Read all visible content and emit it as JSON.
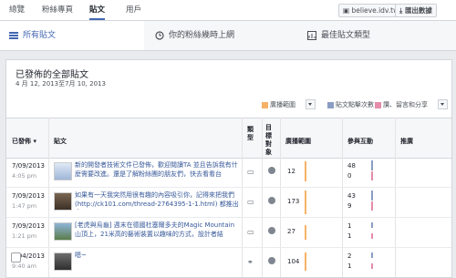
{
  "topnav": {
    "tabs": [
      "總覽",
      "粉絲專頁",
      "貼文",
      "用戶"
    ],
    "active_index": 2,
    "page_url": "believe.idv.tw",
    "export_label": "匯出數據"
  },
  "subnav": {
    "tabs": [
      "所有貼文",
      "你的粉絲幾時上網",
      "最佳貼文類型"
    ]
  },
  "panel": {
    "title": "已發佈的全部貼文",
    "date_range": "4 月 12, 2013至7月 10, 2013",
    "legend": [
      {
        "label": "廣播範圍",
        "color": "#f7b267"
      },
      {
        "label": "貼文點擊次數",
        "color": "#8b9dc3"
      },
      {
        "label": "讚、留言和分享",
        "color": "#e58ca9"
      }
    ]
  },
  "table": {
    "headers": {
      "published": "已發佈",
      "post": "貼文",
      "type": "類型",
      "targeting": "目標對象",
      "reach": "廣播範圍",
      "engagement": "參與互動",
      "promote": "推廣"
    },
    "rows": [
      {
        "date": "7/09/2013",
        "time": "4:05 pm",
        "text": "新的開發者技術文件已發佈，歡迎閱讀TA 並且告訴我有什麼需要改進。還是了解粉絲團的朋友們，快去看看台",
        "reach": "12",
        "clicks": "48",
        "likes": "0"
      },
      {
        "date": "7/09/2013",
        "time": "1:47 pm",
        "text": "如果有一天我突然用很有趣的內容吸引你，記得來把我們 (http://ck101.com/thread-2764395-1-1.html) 都推出去",
        "reach": "173",
        "clicks": "43",
        "likes": "9"
      },
      {
        "date": "7/09/2013",
        "time": "1:21 pm",
        "text": "[老虎與烏龜] 週末在德國杜塞爾多夫的Magic Mountain山頂上，21米高的藝術裝置以趣味的方式，設計者結",
        "reach": "27",
        "clicks": "1",
        "likes": "1"
      },
      {
        "date": "7/04/2013",
        "time": "9:40 am",
        "text": "嗯~",
        "reach": "104",
        "clicks": "2",
        "likes": "1"
      }
    ]
  }
}
